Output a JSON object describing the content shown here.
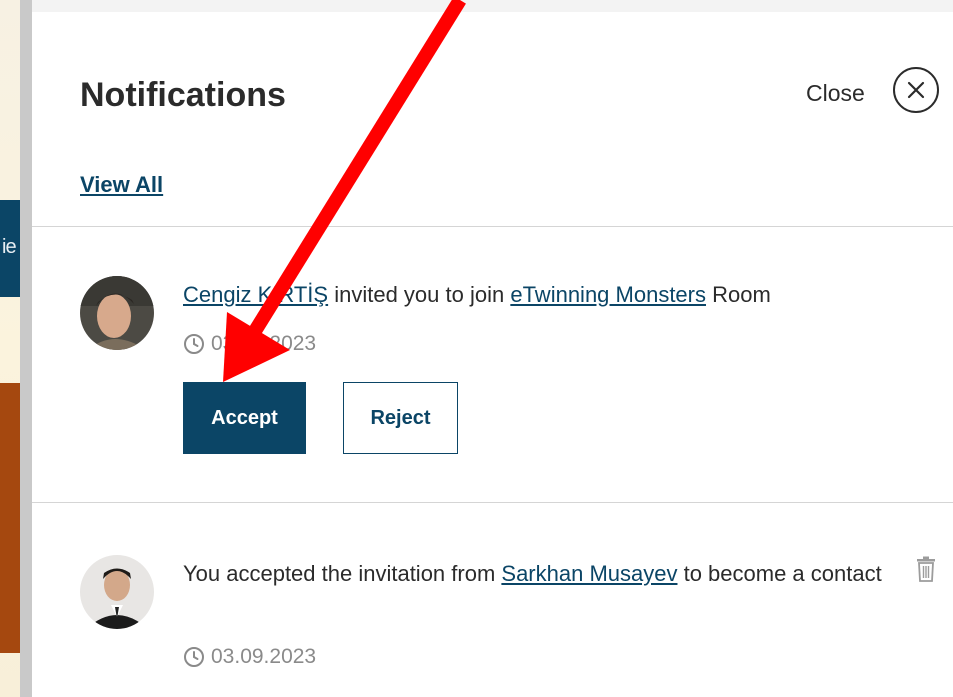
{
  "background": {
    "side_text": "ie"
  },
  "panel": {
    "title": "Notifications",
    "close_label": "Close",
    "view_all_label": "View All"
  },
  "notifications": [
    {
      "user": "Cengiz KIRTİŞ",
      "text_mid": " invited you to join ",
      "link2": "eTwinning Monsters",
      "text_end": " Room",
      "date": "03.09.2023",
      "accept_label": "Accept",
      "reject_label": "Reject"
    },
    {
      "text_start": "You accepted the invitation from ",
      "user": "Sarkhan Musayev",
      "text_end": " to become a contact",
      "date": "03.09.2023"
    }
  ],
  "colors": {
    "accent": "#0b4566",
    "annotation_arrow": "#ff0000"
  },
  "icons": {
    "close": "close-icon",
    "clock": "clock-icon",
    "trash": "trash-icon"
  }
}
